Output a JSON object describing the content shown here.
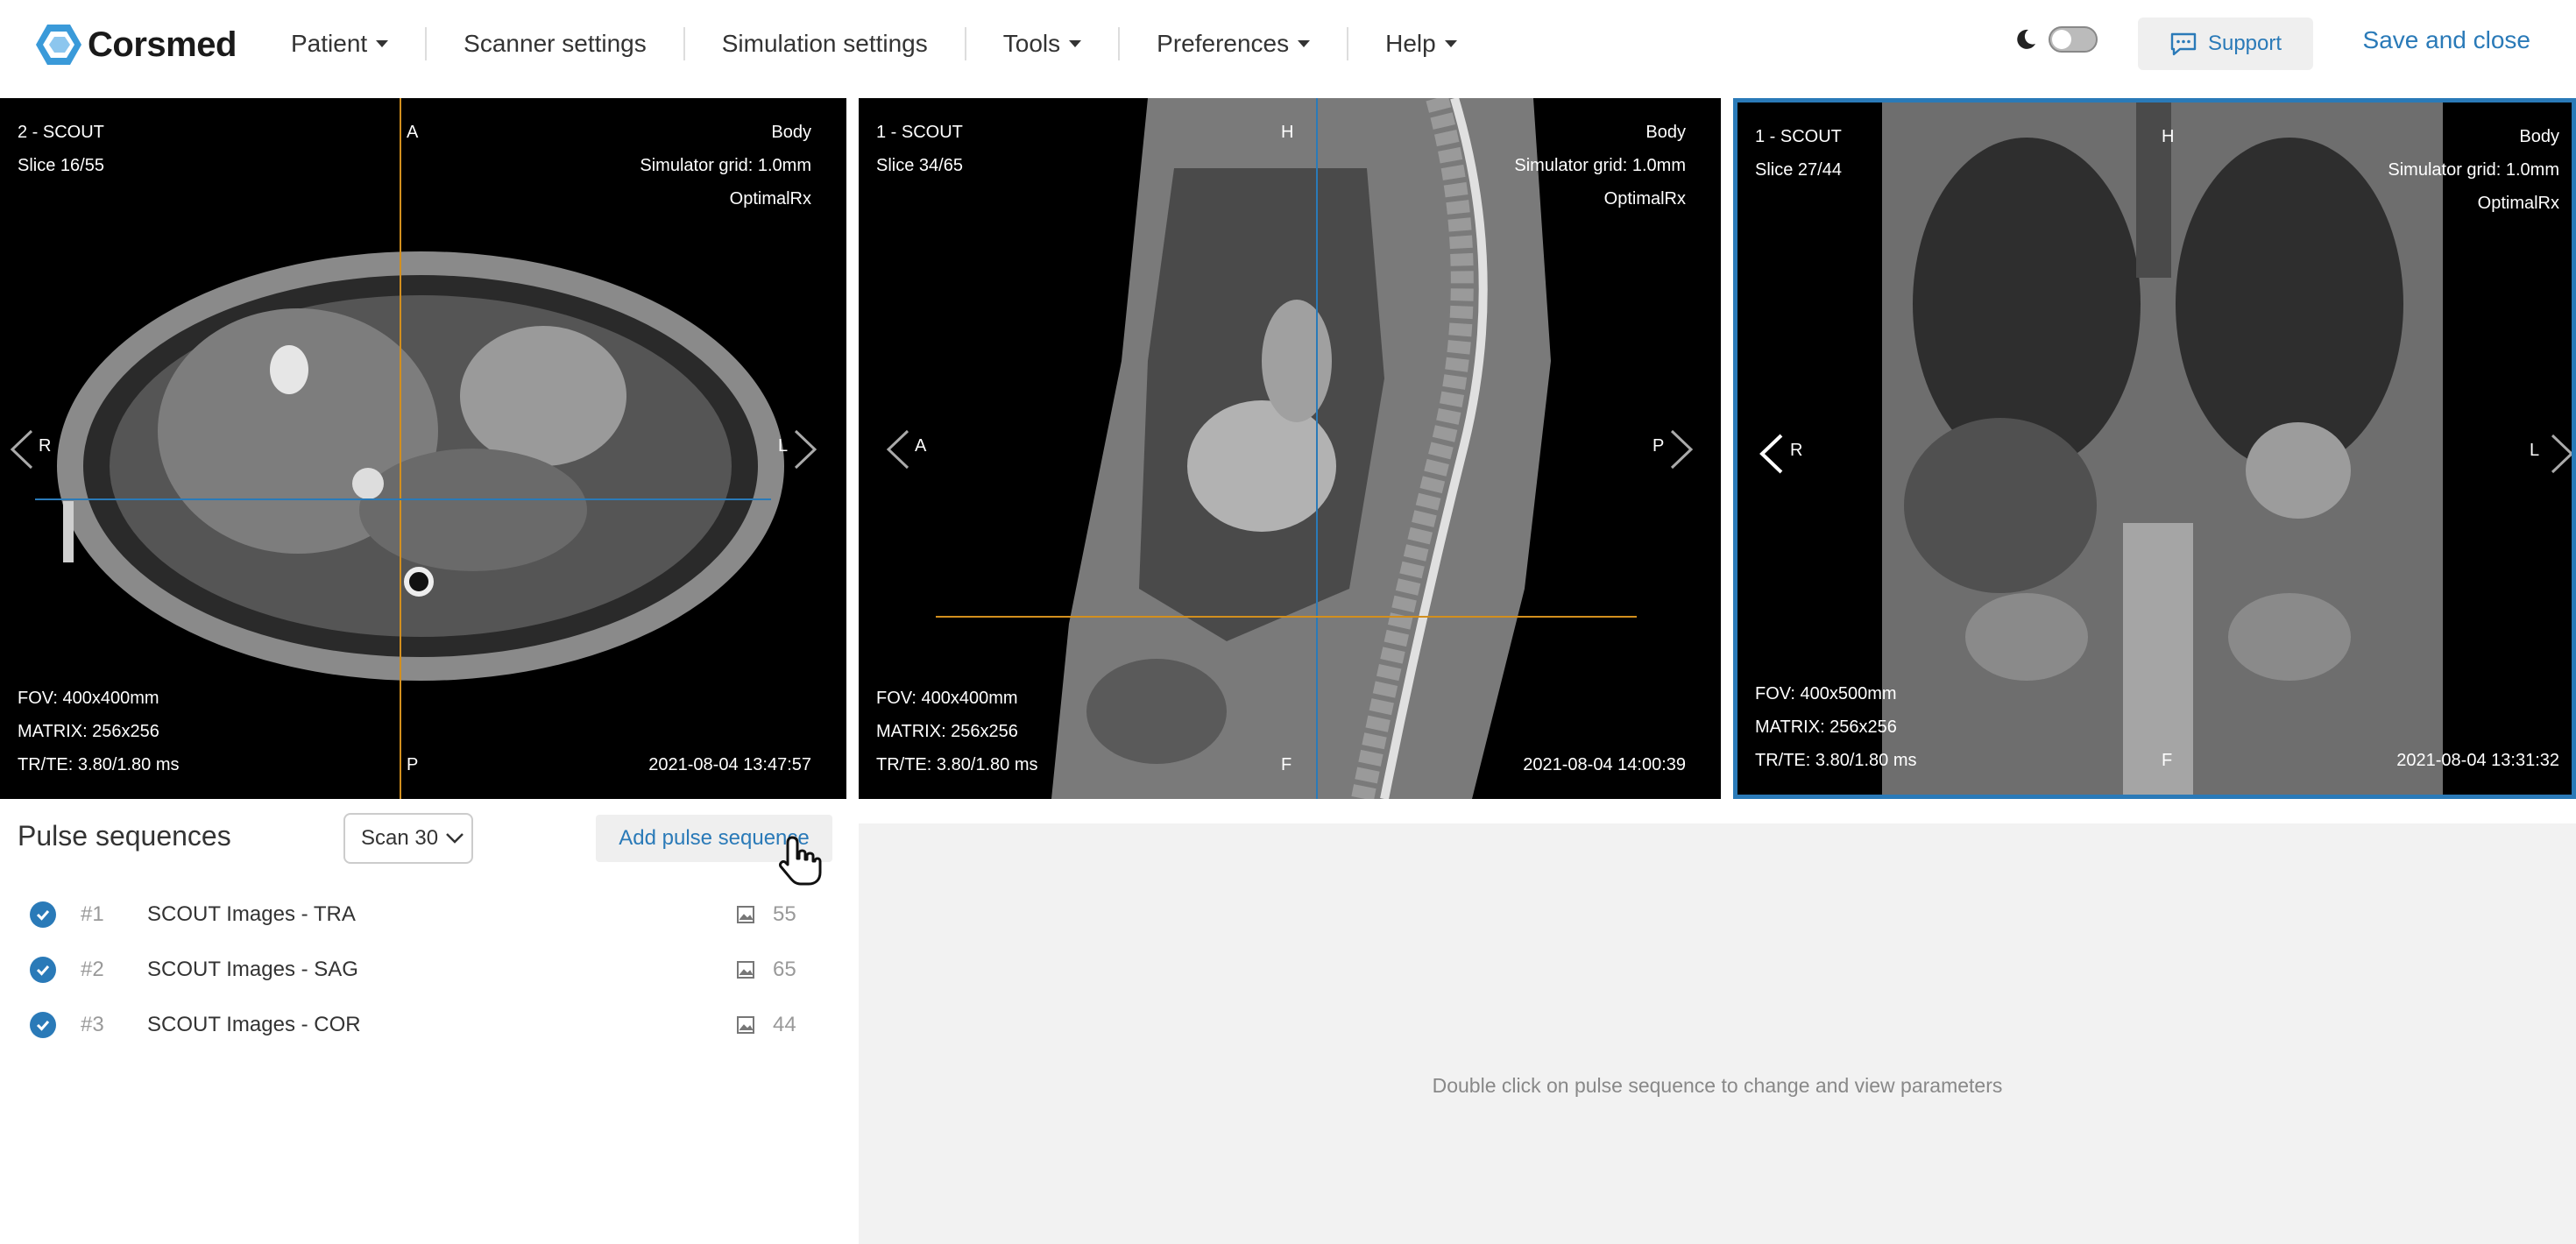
{
  "brand": {
    "name": "Corsmed",
    "accent": "#2a7ab8"
  },
  "nav": {
    "items": [
      {
        "label": "Patient",
        "dropdown": true
      },
      {
        "label": "Scanner settings",
        "dropdown": false
      },
      {
        "label": "Simulation settings",
        "dropdown": false
      },
      {
        "label": "Tools",
        "dropdown": true
      },
      {
        "label": "Preferences",
        "dropdown": true
      },
      {
        "label": "Help",
        "dropdown": true
      }
    ],
    "support_label": "Support",
    "save_label": "Save and close",
    "dark_mode": false
  },
  "viewports": [
    {
      "series": "2 - SCOUT",
      "slice": "Slice 16/55",
      "region": "Body",
      "grid": "Simulator grid: 1.0mm",
      "method": "OptimalRx",
      "fov": "FOV: 400x400mm",
      "matrix": "MATRIX: 256x256",
      "trte": "TR/TE: 3.80/1.80 ms",
      "timestamp": "2021-08-04 13:47:57",
      "top": "A",
      "bottom": "P",
      "left": "R",
      "right": "L",
      "selected": false
    },
    {
      "series": "1 - SCOUT",
      "slice": "Slice 34/65",
      "region": "Body",
      "grid": "Simulator grid: 1.0mm",
      "method": "OptimalRx",
      "fov": "FOV: 400x400mm",
      "matrix": "MATRIX: 256x256",
      "trte": "TR/TE: 3.80/1.80 ms",
      "timestamp": "2021-08-04 14:00:39",
      "top": "H",
      "bottom": "F",
      "left": "A",
      "right": "P",
      "selected": false
    },
    {
      "series": "1 - SCOUT",
      "slice": "Slice 27/44",
      "region": "Body",
      "grid": "Simulator grid: 1.0mm",
      "method": "OptimalRx",
      "fov": "FOV: 400x500mm",
      "matrix": "MATRIX: 256x256",
      "trte": "TR/TE: 3.80/1.80 ms",
      "timestamp": "2021-08-04 13:31:32",
      "top": "H",
      "bottom": "F",
      "left": "R",
      "right": "L",
      "selected": true
    }
  ],
  "pulse_sequences": {
    "title": "Pulse sequences",
    "scan_select": "Scan 30",
    "add_label": "Add pulse sequence",
    "items": [
      {
        "num": "#1",
        "name": "SCOUT Images - TRA",
        "count": "55",
        "done": true
      },
      {
        "num": "#2",
        "name": "SCOUT Images - SAG",
        "count": "65",
        "done": true
      },
      {
        "num": "#3",
        "name": "SCOUT Images - COR",
        "count": "44",
        "done": true
      }
    ]
  },
  "parameters": {
    "hint": "Double click on pulse sequence to change and view parameters"
  }
}
